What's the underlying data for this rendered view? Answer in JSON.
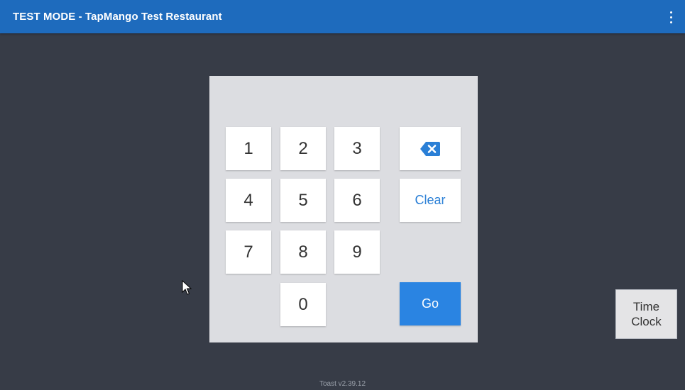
{
  "header": {
    "title": "TEST MODE - TapMango Test Restaurant",
    "menu_icon": "more-vert-icon"
  },
  "keypad": {
    "keys": [
      "1",
      "2",
      "3",
      "4",
      "5",
      "6",
      "7",
      "8",
      "9",
      "0"
    ],
    "backspace_icon": "backspace-icon",
    "clear_label": "Clear",
    "go_label": "Go"
  },
  "time_clock": {
    "line1": "Time",
    "line2": "Clock"
  },
  "footer": {
    "version": "Toast v2.39.12"
  },
  "colors": {
    "topbar": "#1e6bbd",
    "background": "#373c47",
    "pad": "#dcdde1",
    "accent": "#2a84e2"
  }
}
